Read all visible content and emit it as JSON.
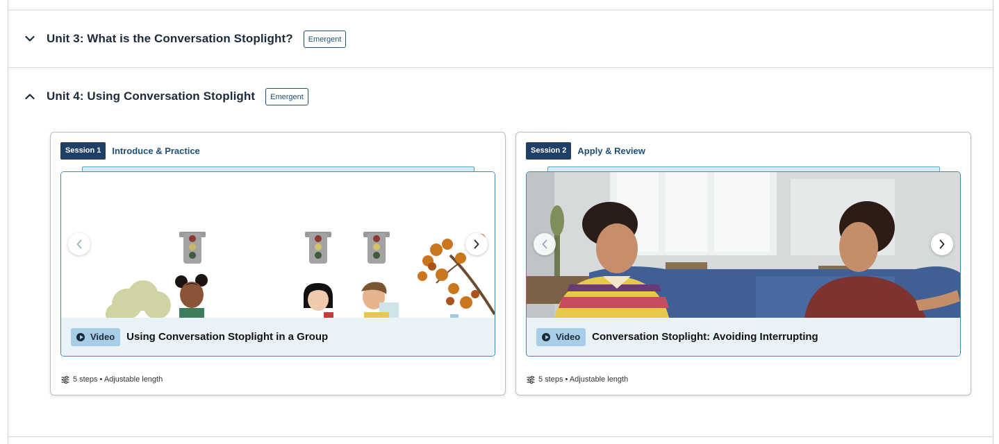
{
  "units": [
    {
      "title": "Unit 3: What is the Conversation Stoplight?",
      "tag": "Emergent",
      "expanded": false,
      "toggle_icon": "chevron-down-icon"
    },
    {
      "title": "Unit 4: Using Conversation Stoplight",
      "tag": "Emergent",
      "expanded": true,
      "toggle_icon": "chevron-up-icon"
    }
  ],
  "sessions": [
    {
      "badge": "Session 1",
      "name": "Introduce & Practice",
      "media_type": "Video",
      "media_title": "Using Conversation Stoplight in a Group",
      "meta": "5 steps • Adjustable length",
      "thumbnail": "illustration of students and traffic lights"
    },
    {
      "badge": "Session 2",
      "name": "Apply & Review",
      "media_type": "Video",
      "media_title": "Conversation Stoplight: Avoiding Interrupting",
      "meta": "5 steps • Adjustable length",
      "thumbnail": "photo of two teens talking in a classroom"
    }
  ],
  "colors": {
    "accent": "#1f4e79",
    "session_badge": "#1f3f66",
    "caption_bg": "#e9f3f7",
    "video_pill": "#a8cde6",
    "media_border": "#3a8bad"
  }
}
